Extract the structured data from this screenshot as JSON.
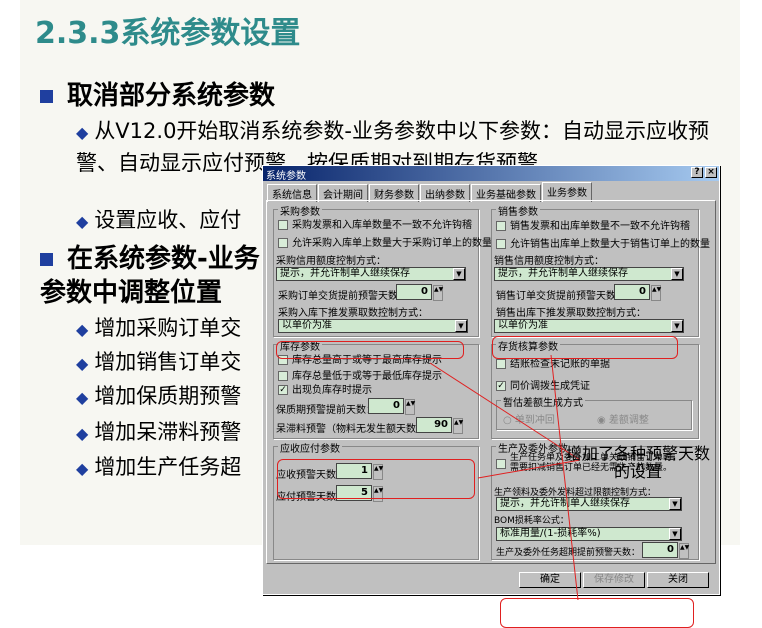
{
  "slide": {
    "title": "2.3.3系统参数设置",
    "h1": "取消部分系统参数",
    "b1": "从V12.0开始取消系统参数-业务参数中以下参数：自动显示应收预警、自动显示应付预警、按保质期对到期存货预警",
    "b2": "设置应收、应付",
    "h2": "在系统参数-业务参数中调整位置",
    "items": [
      "增加采购订单交",
      "增加销售订单交",
      "增加保质期预警",
      "增加呆滞料预警",
      "增加生产任务超"
    ]
  },
  "dialog": {
    "title": "系统参数",
    "help": "?",
    "close": "×",
    "tabs": [
      "系统信息",
      "会计期间",
      "财务参数",
      "出纳参数",
      "业务基础参数",
      "业务参数"
    ],
    "purchase": {
      "label": "采购参数",
      "cb1": "采购发票和入库单数量不一致不允许钩稽",
      "cb2": "允许采购入库单上数量大于采购订单上的数量",
      "credit_label": "采购信用额度控制方式：",
      "credit_value": "提示，并允许制单人继续保存",
      "warn_label": "采购订单交货提前预警天数：",
      "warn_value": "0",
      "push_label": "采购入库下推发票取数控制方式：",
      "push_value": "以单价为准"
    },
    "sales": {
      "label": "销售参数",
      "cb1": "销售发票和出库单数量不一致不允许钩稽",
      "cb2": "允许销售出库单上数量大于销售订单上的数量",
      "credit_label": "销售信用额度控制方式：",
      "credit_value": "提示，并允许制单人继续保存",
      "warn_label": "销售订单交货提前预警天数：",
      "warn_value": "0",
      "push_label": "销售出库下推发票取数控制方式：",
      "push_value": "以单价为准"
    },
    "stock": {
      "label": "库存参数",
      "cb1": "库存总量高于或等于最高库存提示",
      "cb2": "库存总量低于或等于最低库存提示",
      "cb3": "出现负库存时提示",
      "shelf_label": "保质期预警提前天数：",
      "shelf_value": "0",
      "idle_label": "呆滞料预警（物料无发生额天数）：",
      "idle_value": "90"
    },
    "arap": {
      "label": "应收应付参数",
      "ar_label": "应收预警天数：",
      "ar_value": "1",
      "ap_label": "应付预警天数：",
      "ap_value": "5"
    },
    "costing": {
      "label": "存货核算参数",
      "cb1": "结账检查未记账的单据",
      "cb2": "同价调拨生成凭证",
      "est_label": "暂估差额生成方式",
      "r1": "单到冲回",
      "r2": "差额调整"
    },
    "production": {
      "label": "生产及委外参数",
      "cb1": "生产任务单及委外加工单关联销售订单时，需要扣减销售订单已经无需生产的数量。",
      "limit_label": "生产领料及委外发料超过限额控制方式：",
      "limit_value": "提示，并允许制单人继续保存",
      "bom_label": "BOM损耗率公式：",
      "bom_value": "标准用量/(1-损耗率%)",
      "overdue_label": "生产及委外任务超期提前预警天数：",
      "overdue_value": "0"
    },
    "buttons": {
      "ok": "确定",
      "save": "保存修改",
      "close": "关闭"
    }
  },
  "annotation": "增加了各种预警天数的设置"
}
